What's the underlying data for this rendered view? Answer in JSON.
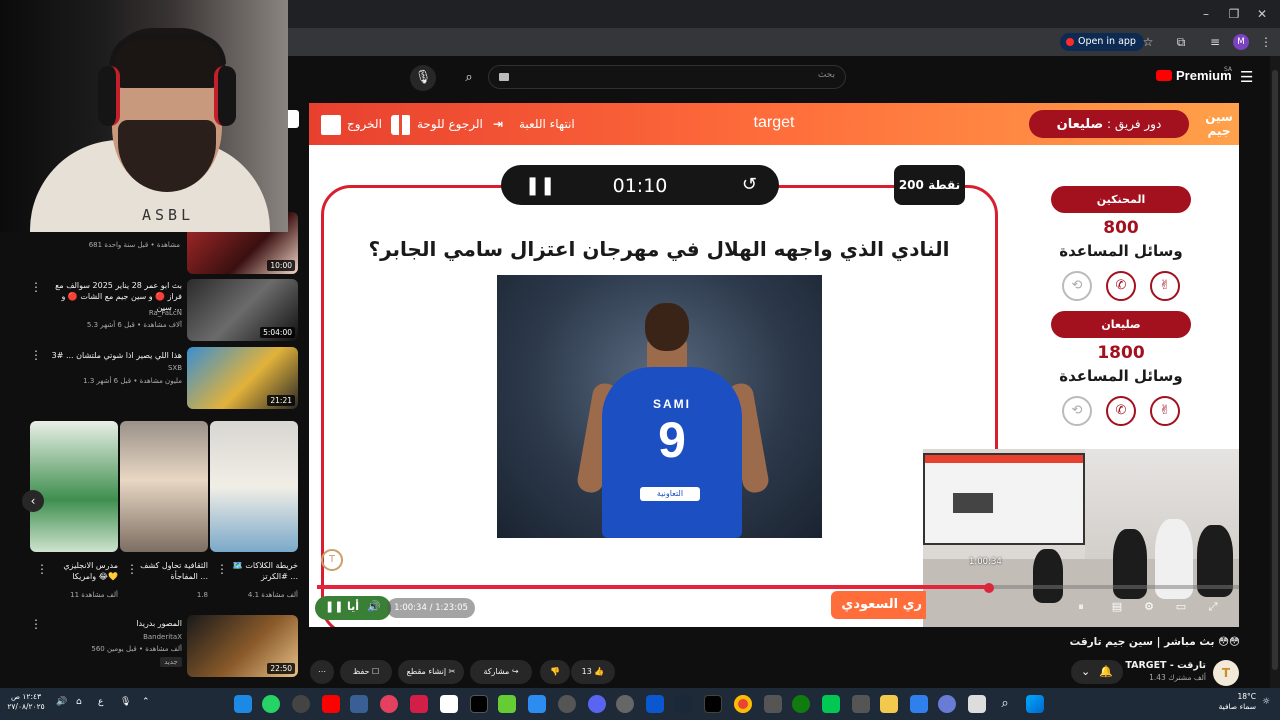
{
  "browser": {
    "open_in_app": "Open in app",
    "profile_initial": "M"
  },
  "youtube": {
    "search_placeholder": "بحث",
    "brand": "Premium",
    "country": "SA"
  },
  "webcam": {
    "shirt_text": "ASBL"
  },
  "sidebar": {
    "items": [
      {
        "title": "",
        "channel": "",
        "meta": "681 مشاهدة • قبل سنة واحدة",
        "duration": "10:00"
      },
      {
        "title": "بث ابو عمر 28 يناير 2025 سوالف مع فراز 🔴 و سين جيم مع الشات 🔴 و سين ...",
        "channel": "Ra_FaLcN",
        "meta": "5.3 آلاف مشاهدة • قبل 6 أشهر",
        "duration": "5:04:00"
      },
      {
        "title": "هذا اللي يصير اذا شوتي ملتشان ... #3",
        "channel": "SXB",
        "meta": "1.3 مليون مشاهدة • قبل 6 أشهر",
        "duration": "21:21"
      },
      {
        "title": "المصور بدريدا",
        "channel": "BanderitaX",
        "meta": "560 ألف مشاهدة • قبل يومين",
        "badge": "جديد",
        "duration": "22:50"
      }
    ],
    "shorts": [
      {
        "title": "مدرس الانجليزي وامريكا 😂💛",
        "views": "11 ألف مشاهدة"
      },
      {
        "title": "الثقافية تحاول كشف المفاجأة ...",
        "views": "1.8"
      },
      {
        "title": "خريطة الكلاكات 🗺️ #الكرتز ...",
        "views": "4.1 ألف مشاهدة"
      }
    ]
  },
  "game": {
    "exit_label": "الخروج",
    "back_label": "الرجوع للوحة",
    "end_label": "انتهاء اللعبة",
    "title": "target",
    "turn_label": "دور فريق :",
    "turn_team": "صليعان",
    "logo": "سين جيم",
    "timer": "01:10",
    "points": "200 نقطة",
    "question": "النادي الذي واجهه الهلال في مهرجان اعتزال سامي الجابر؟",
    "jersey_name": "SAMI",
    "jersey_number": "9",
    "jersey_sponsor": "التعاونية",
    "teams": [
      {
        "name": "المحنكين",
        "score": "800",
        "aids_label": "وسائل المساعدة"
      },
      {
        "name": "صليعان",
        "score": "1800",
        "aids_label": "وسائل المساعدة"
      }
    ]
  },
  "player": {
    "current_time": "1:00:34",
    "total_time": "1:23:05",
    "time_display": "1:00:34 / 1:23:05",
    "progress": 0.7289,
    "live_text": "أيا",
    "banner_text": "ري السعودي",
    "preview_time": "1:00:34"
  },
  "video": {
    "title": "بث مباشر | سين جيم تارقت 😳😳",
    "channel_name": "TARGET - تارقت",
    "subscribers": "1.43 ألف مشترك",
    "likes": "13",
    "share_label": "مشاركة",
    "clip_label": "إنشاء مقطع",
    "save_label": "حفظ"
  },
  "taskbar": {
    "time": "١٢:٤٣ ص",
    "date": "٢٧/٠٨/٢٠٢٥",
    "temperature": "18°C",
    "weather": "سماء صافية",
    "lang": "ع"
  },
  "colors": {
    "accent_red": "#a3101e",
    "frame_red": "#d91f2f",
    "topbar_start": "#e8402f",
    "topbar_end": "#ffa14a",
    "seek_red": "#e3243b"
  }
}
